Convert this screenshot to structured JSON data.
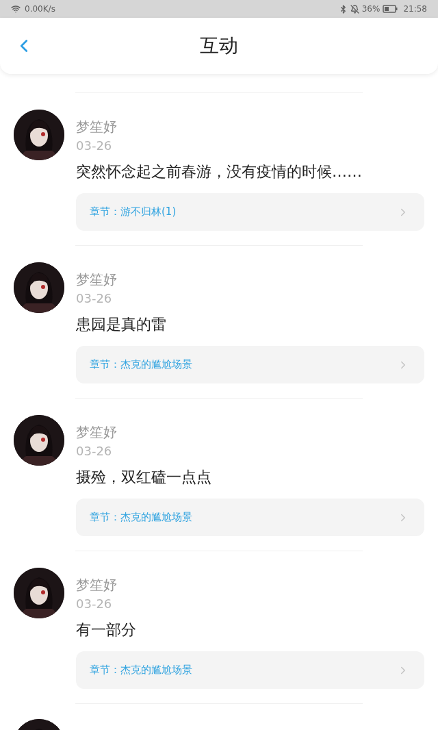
{
  "status_bar": {
    "speed": "0.00K/s",
    "battery": "36%",
    "time": "21:58"
  },
  "header": {
    "title": "互动"
  },
  "posts": [
    {
      "name": "梦笙妤",
      "date": "03-26",
      "content": "突然怀念起之前春游，没有疫情的时候……",
      "chapter": "章节：游不归林(1)"
    },
    {
      "name": "梦笙妤",
      "date": "03-26",
      "content": "患园是真的雷",
      "chapter": "章节：杰克的尴尬场景"
    },
    {
      "name": "梦笙妤",
      "date": "03-26",
      "content": "摄殓，双红磕一点点",
      "chapter": "章节：杰克的尴尬场景"
    },
    {
      "name": "梦笙妤",
      "date": "03-26",
      "content": "有一部分",
      "chapter": "章节：杰克的尴尬场景"
    }
  ],
  "peek_avatar": true
}
